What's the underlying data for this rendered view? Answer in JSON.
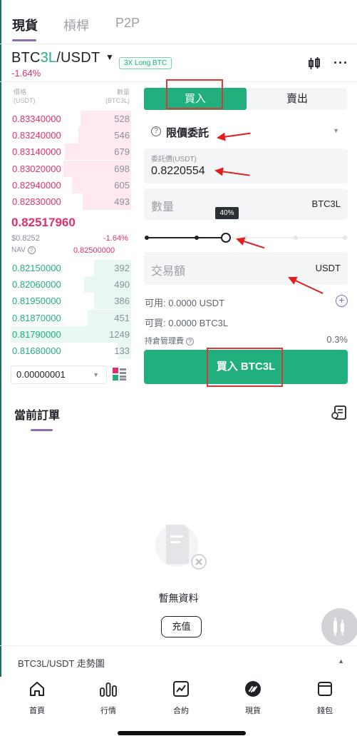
{
  "tabs": [
    {
      "label": "現貨"
    },
    {
      "label": "槓桿"
    },
    {
      "label": "P2P"
    }
  ],
  "pair": {
    "base": "BTC",
    "highlight": "3L",
    "quote": "/USDT",
    "badge": "3X Long BTC",
    "change": "-1.64%"
  },
  "orderbook": {
    "price_header": [
      "價格",
      "(USDT)"
    ],
    "qty_header": [
      "數量",
      "(BTC3L)"
    ],
    "asks": [
      {
        "price": "0.83340000",
        "qty": "528",
        "depth": 0.42
      },
      {
        "price": "0.83240000",
        "qty": "546",
        "depth": 0.44
      },
      {
        "price": "0.83140000",
        "qty": "679",
        "depth": 0.55
      },
      {
        "price": "0.83020000",
        "qty": "698",
        "depth": 0.56
      },
      {
        "price": "0.82940000",
        "qty": "605",
        "depth": 0.49
      },
      {
        "price": "0.82830000",
        "qty": "493",
        "depth": 0.4
      }
    ],
    "last_price": "0.82517960",
    "usd_value": "$0.8252",
    "change": "-1.64%",
    "nav_label": "NAV",
    "nav_value": "0.82500000",
    "bids": [
      {
        "price": "0.82150000",
        "qty": "392",
        "depth": 0.31
      },
      {
        "price": "0.82060000",
        "qty": "490",
        "depth": 0.39
      },
      {
        "price": "0.81950000",
        "qty": "386",
        "depth": 0.31
      },
      {
        "price": "0.81870000",
        "qty": "451",
        "depth": 0.36
      },
      {
        "price": "0.81790000",
        "qty": "1249",
        "depth": 1.0
      },
      {
        "price": "0.81680000",
        "qty": "133",
        "depth": 0.11
      }
    ],
    "precision": "0.00000001"
  },
  "trade": {
    "buy_tab": "買入",
    "sell_tab": "賣出",
    "order_type": "限價委託",
    "price_label": "委託價(USDT)",
    "price_value": "0.8220554",
    "amount_placeholder": "數量",
    "amount_unit": "BTC3L",
    "slider_percent": "40%",
    "slider_fraction": 0.4,
    "total_placeholder": "交易額",
    "total_unit": "USDT",
    "available_label": "可用:",
    "available_value": "0.0000 USDT",
    "buyable_label": "可買:",
    "buyable_value": "0.0000 BTC3L",
    "fee_label": "持倉管理費",
    "fee_value": "0.3%",
    "buy_button": "買入 BTC3L"
  },
  "orders": {
    "title": "當前訂單",
    "empty_text": "暫無資料",
    "deposit_button": "充值"
  },
  "chart_bar": {
    "label": "BTC3L/USDT 走勢圖"
  },
  "bottom_nav": [
    {
      "label": "首頁",
      "icon": "home-icon"
    },
    {
      "label": "行情",
      "icon": "market-icon"
    },
    {
      "label": "合約",
      "icon": "futures-icon"
    },
    {
      "label": "現貨",
      "icon": "spot-icon"
    },
    {
      "label": "錢包",
      "icon": "wallet-icon"
    }
  ],
  "colors": {
    "accent_green": "#21b07d",
    "accent_red": "#e0306c",
    "annotation_red": "#d93838",
    "underline_purple": "#8b6fb0"
  }
}
